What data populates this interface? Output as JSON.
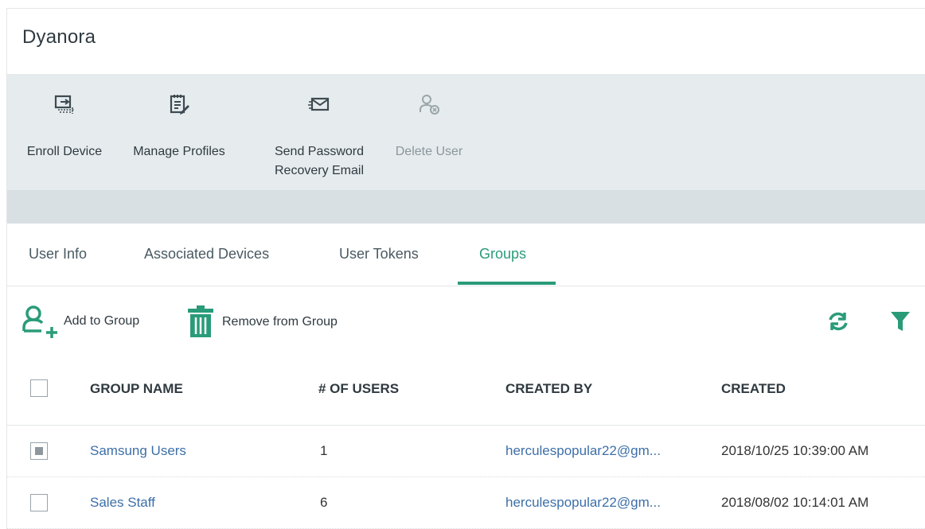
{
  "header": {
    "title": "Dyanora"
  },
  "toolbar": {
    "enroll_label": "Enroll Device",
    "manage_label": "Manage Profiles",
    "send_label_line1": "Send Password",
    "send_label_line2": "Recovery Email",
    "delete_label": "Delete User"
  },
  "tabs": [
    {
      "label": "User Info"
    },
    {
      "label": "Associated Devices"
    },
    {
      "label": "User Tokens"
    },
    {
      "label": "Groups",
      "active": true
    }
  ],
  "actions": {
    "add_label": "Add to Group",
    "remove_label": "Remove from Group"
  },
  "table": {
    "headers": [
      "GROUP NAME",
      "# OF USERS",
      "CREATED BY",
      "CREATED"
    ],
    "rows": [
      {
        "name": "Samsung Users",
        "users": "1",
        "created_by": "herculespopular22@gm...",
        "created": "2018/10/25 10:39:00 AM",
        "checked": true
      },
      {
        "name": "Sales Staff",
        "users": "6",
        "created_by": "herculespopular22@gm...",
        "created": "2018/08/02 10:14:01 AM",
        "checked": false
      }
    ]
  },
  "colors": {
    "accent": "#2a9b79",
    "link": "#3c6fa8",
    "toolbar_bg": "#e6ebee"
  }
}
